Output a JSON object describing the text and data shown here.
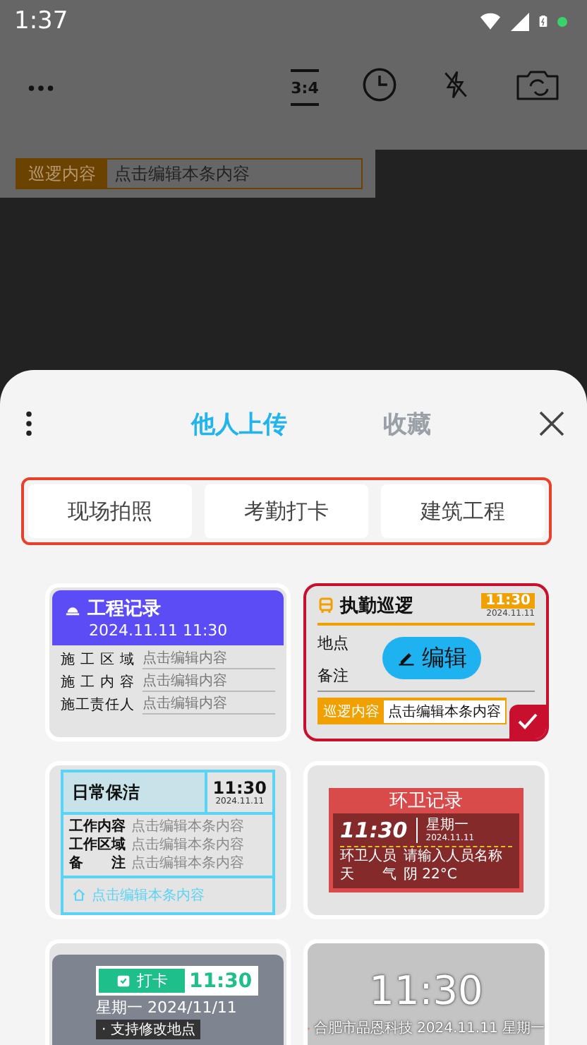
{
  "status_bar": {
    "time": "1:37"
  },
  "camera_toolbar": {
    "ratio": "3:4"
  },
  "watermark_preview": {
    "label": "巡逻内容",
    "value": "点击编辑本条内容"
  },
  "sheet": {
    "tabs": [
      {
        "label": "他人上传",
        "selected": true
      },
      {
        "label": "收藏",
        "selected": false
      }
    ],
    "categories": [
      "现场拍照",
      "考勤打卡",
      "建筑工程"
    ],
    "templates": [
      {
        "kind": "engineering",
        "selected": false,
        "title": "工程记录",
        "datetime": "2024.11.11 11:30",
        "rows": [
          {
            "label": "施工区域",
            "value": "点击编辑内容"
          },
          {
            "label": "施工内容",
            "value": "点击编辑内容"
          },
          {
            "label": "施工责任人",
            "value": "点击编辑内容"
          }
        ]
      },
      {
        "kind": "patrol",
        "selected": true,
        "title": "执勤巡逻",
        "time": "11:30",
        "date": "2024.11.11",
        "rows": [
          {
            "label": "地点"
          },
          {
            "label": "备注"
          }
        ],
        "content_label": "巡逻内容",
        "content_value": "点击编辑本条内容",
        "edit_button": "编辑"
      },
      {
        "kind": "cleaning",
        "selected": false,
        "title": "日常保洁",
        "time": "11:30",
        "date": "2024.11.11",
        "rows": [
          {
            "label": "工作内容",
            "value": "点击编辑本条内容"
          },
          {
            "label": "工作区域",
            "value": "点击编辑本条内容"
          },
          {
            "label": "备注",
            "value": "点击编辑本条内容"
          }
        ],
        "footer": "点击编辑本条内容"
      },
      {
        "kind": "sanitation",
        "selected": false,
        "title": "环卫记录",
        "time": "11:30",
        "weekday": "星期一",
        "date": "2024.11.11",
        "rows": [
          {
            "label": "环卫人员",
            "value": "请输入人员名称"
          },
          {
            "label": "天气",
            "value": "阴 22°C"
          }
        ]
      },
      {
        "kind": "checkin",
        "selected": false,
        "tag": "打卡",
        "time": "11:30",
        "date_line": "星期一 2024/11/11",
        "note": "· 支持修改地点"
      },
      {
        "kind": "location",
        "selected": false,
        "time": "11:30",
        "address": "合肥市品恩科技",
        "date": "2024.11.11",
        "weekday": "星期一"
      }
    ]
  }
}
